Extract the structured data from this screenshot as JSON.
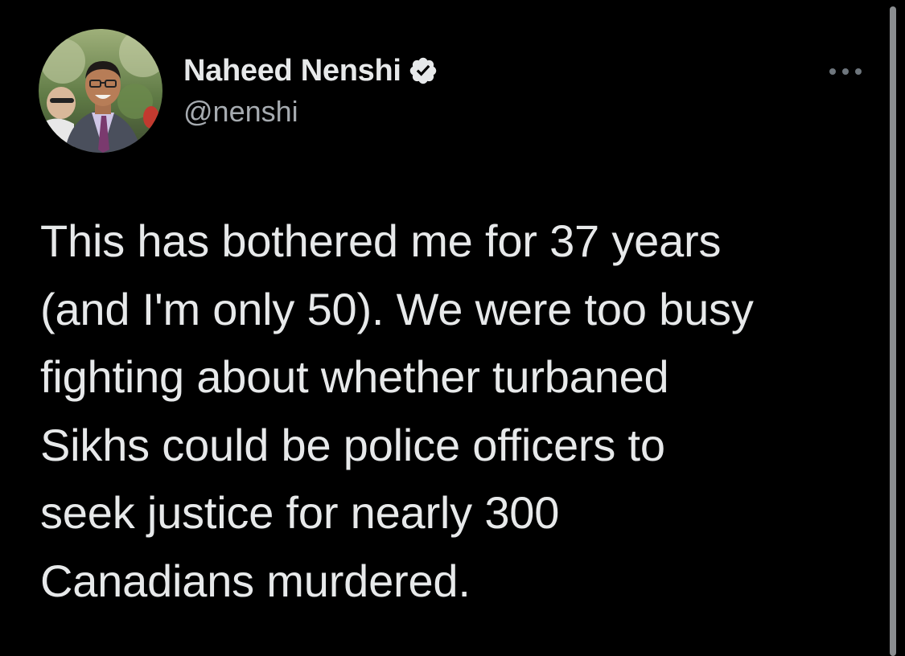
{
  "author": {
    "display_name": "Naheed Nenshi",
    "handle": "@nenshi",
    "verified": true,
    "avatar_icon": "profile-photo"
  },
  "menu": {
    "icon": "more-horizontal-icon"
  },
  "tweet": {
    "lines": [
      "This has bothered me for 37 years",
      "(and I'm only 50). We were too busy",
      "fighting about whether turbaned",
      "Sikhs could be police officers to",
      "seek justice for nearly 300",
      "Canadians murdered."
    ]
  },
  "colors": {
    "background": "#000000",
    "text_primary": "#e7e9ea",
    "text_secondary": "#a6abb0",
    "verified_badge": "#e7e9ea",
    "scrollbar": "#8a8d90"
  }
}
